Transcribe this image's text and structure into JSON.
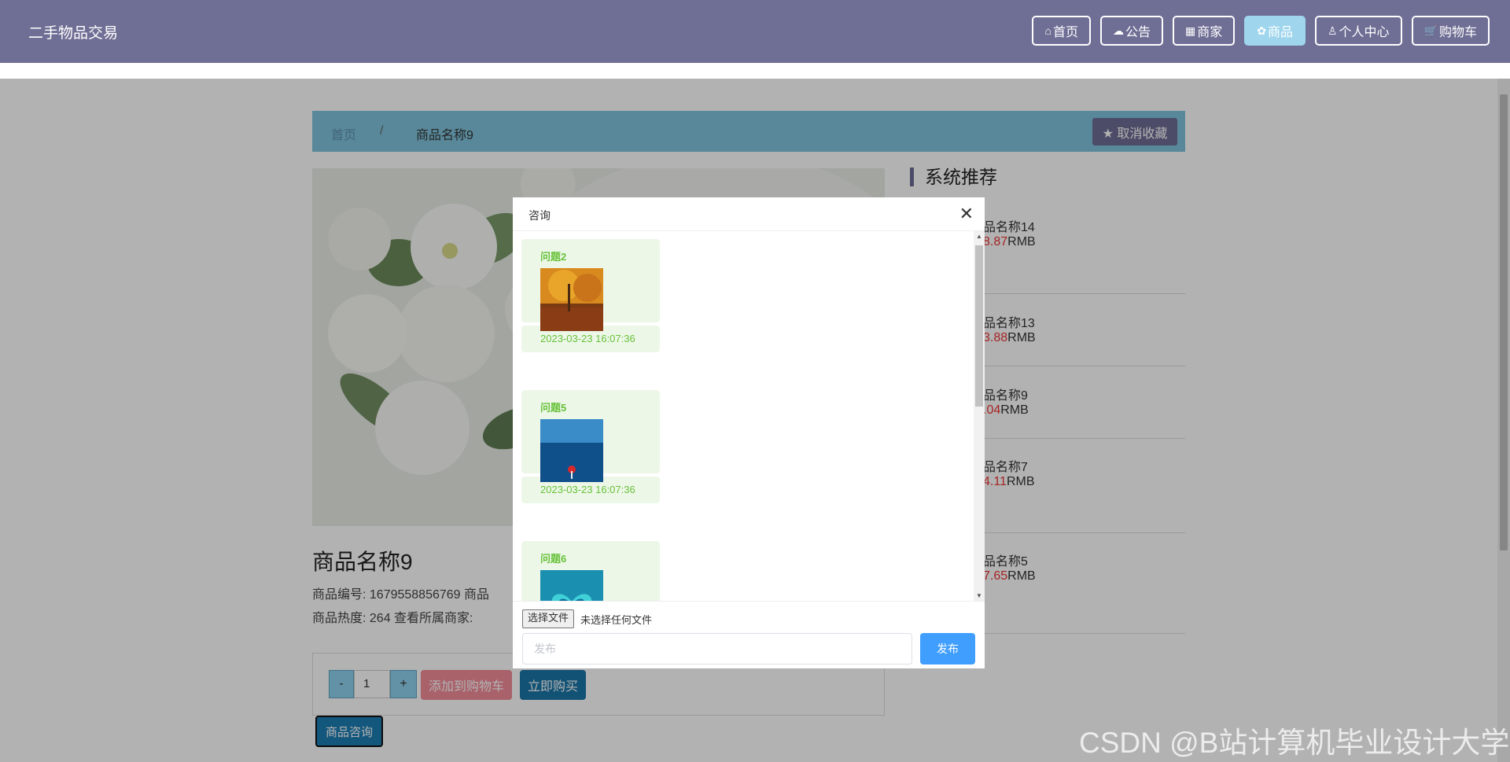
{
  "app": {
    "title": "二手物品交易"
  },
  "nav": [
    {
      "icon": "⌂",
      "label": "首页",
      "active": false
    },
    {
      "icon": "☁",
      "label": "公告",
      "active": false
    },
    {
      "icon": "▦",
      "label": "商家",
      "active": false
    },
    {
      "icon": "✿",
      "label": "商品",
      "active": true
    },
    {
      "icon": "♙",
      "label": "个人中心",
      "active": false
    },
    {
      "icon": "🛒",
      "label": "购物车",
      "active": false
    }
  ],
  "breadcrumb": {
    "home": "首页",
    "separator": "/",
    "current": "商品名称9"
  },
  "favorite_button": "★ 取消收藏",
  "product": {
    "name": "商品名称9",
    "line1": "商品编号:   1679558856769    商品",
    "line2": "商品热度:   264    查看所属商家:",
    "quantity": "1",
    "minus": "-",
    "plus": "+",
    "add_to_cart": "添加到购物车",
    "buy_now": "立即购买",
    "consult": "商品咨询"
  },
  "recommend": {
    "title": "系统推荐",
    "items": [
      {
        "name": "品名称14",
        "price_num": "8.87",
        "unit": "RMB"
      },
      {
        "name": "品名称13",
        "price_num": "3.88",
        "unit": "RMB"
      },
      {
        "name": "品名称9",
        "price_num": ".04",
        "unit": "RMB"
      },
      {
        "name": "品名称7",
        "price_num": "4.11",
        "unit": "RMB"
      },
      {
        "name": "品名称5",
        "price_num": "7.65",
        "unit": "RMB"
      }
    ]
  },
  "dialog": {
    "title": "咨询",
    "close": "✕",
    "messages": [
      {
        "question": "问题2",
        "time": "2023-03-23 16:07:36"
      },
      {
        "question": "问题5",
        "time": "2023-03-23 16:07:36"
      },
      {
        "question": "问题6",
        "time": ""
      }
    ],
    "file_button": "选择文件",
    "file_status": "未选择任何文件",
    "input_placeholder": "发布",
    "submit": "发布"
  },
  "watermark": "CSDN @B站计算机毕业设计大学"
}
